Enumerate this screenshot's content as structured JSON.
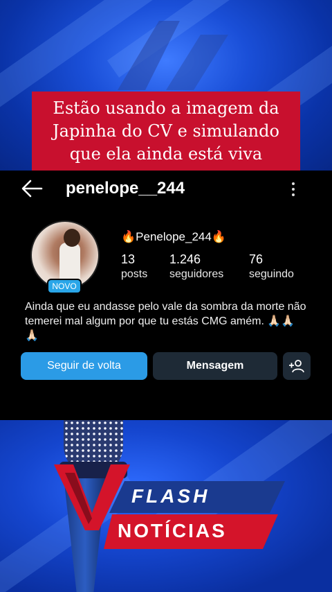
{
  "headline": {
    "text": "Estão usando a imagem da Japinha do CV e simulando que ela ainda está viva"
  },
  "profile": {
    "username": "penelope__244",
    "display_name": "🔥Penelope_244🔥",
    "badge": "NOVO",
    "stats": [
      {
        "value": "13",
        "label": "posts"
      },
      {
        "value": "1.246",
        "label": "seguidores"
      },
      {
        "value": "76",
        "label": "seguindo"
      }
    ],
    "bio": "Ainda que eu andasse pelo vale da sombra da morte não temerei mal algum por que tu estás CMG amém. 🙏🏻🙏🏻🙏🏻",
    "buttons": {
      "follow_back": "Seguir de volta",
      "message": "Mensagem"
    }
  },
  "branding": {
    "line1": "FLASH",
    "line2": "NOTÍCIAS"
  },
  "colors": {
    "background_blue": "#1546cf",
    "headline_red": "#c8102e",
    "profile_bg": "#000000",
    "follow_button": "#2b9be6",
    "secondary_button": "#1e2a36",
    "badge": "#2aa6e8"
  },
  "icons": {
    "back": "arrow-left-icon",
    "more": "more-vertical-icon",
    "add_user": "add-user-icon",
    "microphone": "microphone-icon"
  }
}
